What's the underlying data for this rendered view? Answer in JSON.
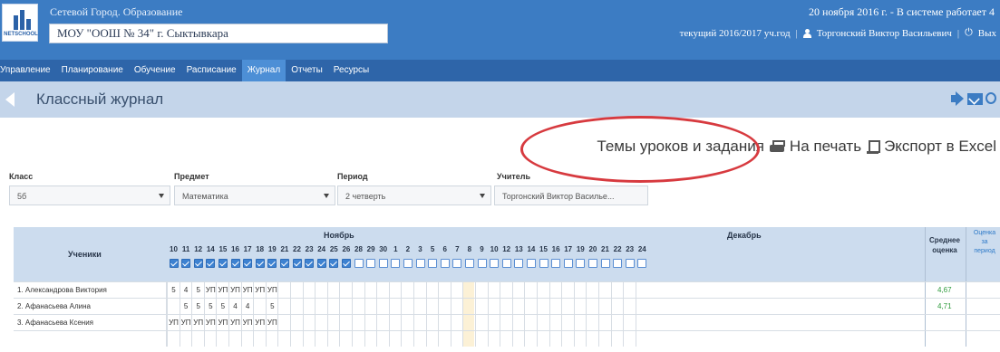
{
  "header": {
    "portal_name": "Сетевой Город. Образование",
    "school": "МОУ \"ООШ № 34\" г. Сыктывкара",
    "date_status": "20 ноября 2016 г. - В системе работает 4",
    "current_year": "текущий 2016/2017 уч.год",
    "user_name": "Торгонский Виктор Васильевич",
    "exit_label": "Вых",
    "logo_text": "NETSCHOOL",
    "brand_color": "#3c7cc3"
  },
  "nav": {
    "items": [
      "Управление",
      "Планирование",
      "Обучение",
      "Расписание",
      "Журнал",
      "Отчеты",
      "Ресурсы"
    ],
    "active": "Журнал"
  },
  "page": {
    "title": "Классный журнал"
  },
  "actions": {
    "themes": "Темы уроков и задания",
    "print": "На печать",
    "export": "Экспорт в Excel"
  },
  "filters": {
    "class": {
      "label": "Класс",
      "value": "5б"
    },
    "subject": {
      "label": "Предмет",
      "value": "Математика"
    },
    "period": {
      "label": "Период",
      "value": "2 четверть"
    },
    "teacher": {
      "label": "Учитель",
      "value": "Торгонский Виктор Васильe..."
    }
  },
  "journal": {
    "students_header": "Ученики",
    "avg_header_l1": "Среднее",
    "avg_header_l2": "оценка",
    "period_header_l1": "Оценка",
    "period_header_l2": "за",
    "period_header_l3": "период",
    "months": [
      {
        "name": "Ноябрь",
        "days": [
          "10",
          "11",
          "12",
          "14",
          "15",
          "16",
          "17",
          "18",
          "19",
          "21",
          "22",
          "23",
          "24",
          "25",
          "26",
          "28",
          "29",
          "30"
        ]
      },
      {
        "name": "Декабрь",
        "days": [
          "1",
          "2",
          "3",
          "5",
          "6",
          "7",
          "8",
          "9",
          "10",
          "12",
          "13",
          "14",
          "15",
          "16",
          "17",
          "19",
          "20",
          "21",
          "22",
          "23",
          "24"
        ]
      }
    ],
    "checked_days": 15,
    "students": [
      {
        "name": "1. Александрова Виктория",
        "grades": [
          "5",
          "4",
          "5",
          "УП",
          "УП",
          "УП",
          "УП",
          "УП",
          "УП"
        ],
        "avg": "4,67"
      },
      {
        "name": "2. Афанасьева Алина",
        "grades": [
          "",
          "5",
          "5",
          "5",
          "5",
          "4",
          "4",
          "",
          "5"
        ],
        "avg": "4,71"
      },
      {
        "name": "3. Афанасьева Ксения",
        "grades": [
          "УП",
          "УП",
          "УП",
          "УП",
          "УП",
          "УП",
          "УП",
          "УП",
          "УП"
        ],
        "avg": ""
      }
    ]
  }
}
